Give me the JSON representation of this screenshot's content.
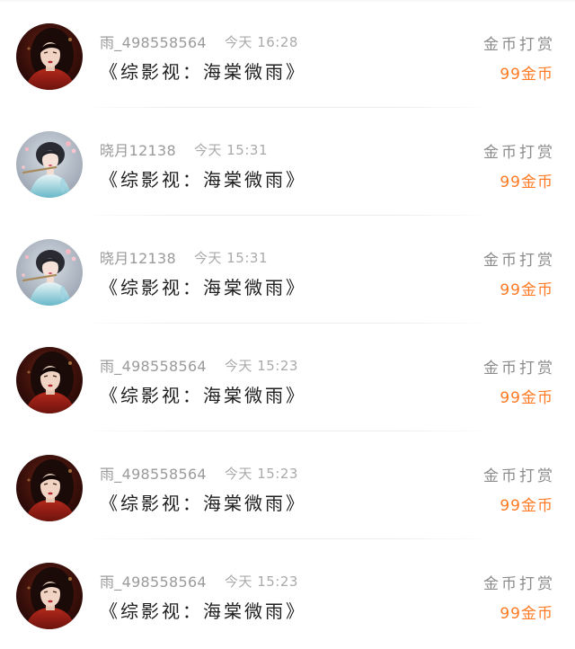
{
  "colors": {
    "accent": "#ff7a24",
    "meta_text": "#9a9a9a",
    "title_text": "#1e1e1e",
    "divider": "#ececec"
  },
  "rewards": [
    {
      "avatar_icon": "avatar-red-robe-woman",
      "username": "雨_498558564",
      "time": "今天 16:28",
      "book_title": "《综影视：海棠微雨》",
      "action": "金币打赏",
      "amount": "99金币"
    },
    {
      "avatar_icon": "avatar-flute-woman",
      "username": "晓月12138",
      "time": "今天 15:31",
      "book_title": "《综影视：海棠微雨》",
      "action": "金币打赏",
      "amount": "99金币"
    },
    {
      "avatar_icon": "avatar-flute-woman",
      "username": "晓月12138",
      "time": "今天 15:31",
      "book_title": "《综影视：海棠微雨》",
      "action": "金币打赏",
      "amount": "99金币"
    },
    {
      "avatar_icon": "avatar-red-robe-woman",
      "username": "雨_498558564",
      "time": "今天 15:23",
      "book_title": "《综影视：海棠微雨》",
      "action": "金币打赏",
      "amount": "99金币"
    },
    {
      "avatar_icon": "avatar-red-robe-woman",
      "username": "雨_498558564",
      "time": "今天 15:23",
      "book_title": "《综影视：海棠微雨》",
      "action": "金币打赏",
      "amount": "99金币"
    },
    {
      "avatar_icon": "avatar-red-robe-woman",
      "username": "雨_498558564",
      "time": "今天 15:23",
      "book_title": "《综影视：海棠微雨》",
      "action": "金币打赏",
      "amount": "99金币"
    }
  ]
}
